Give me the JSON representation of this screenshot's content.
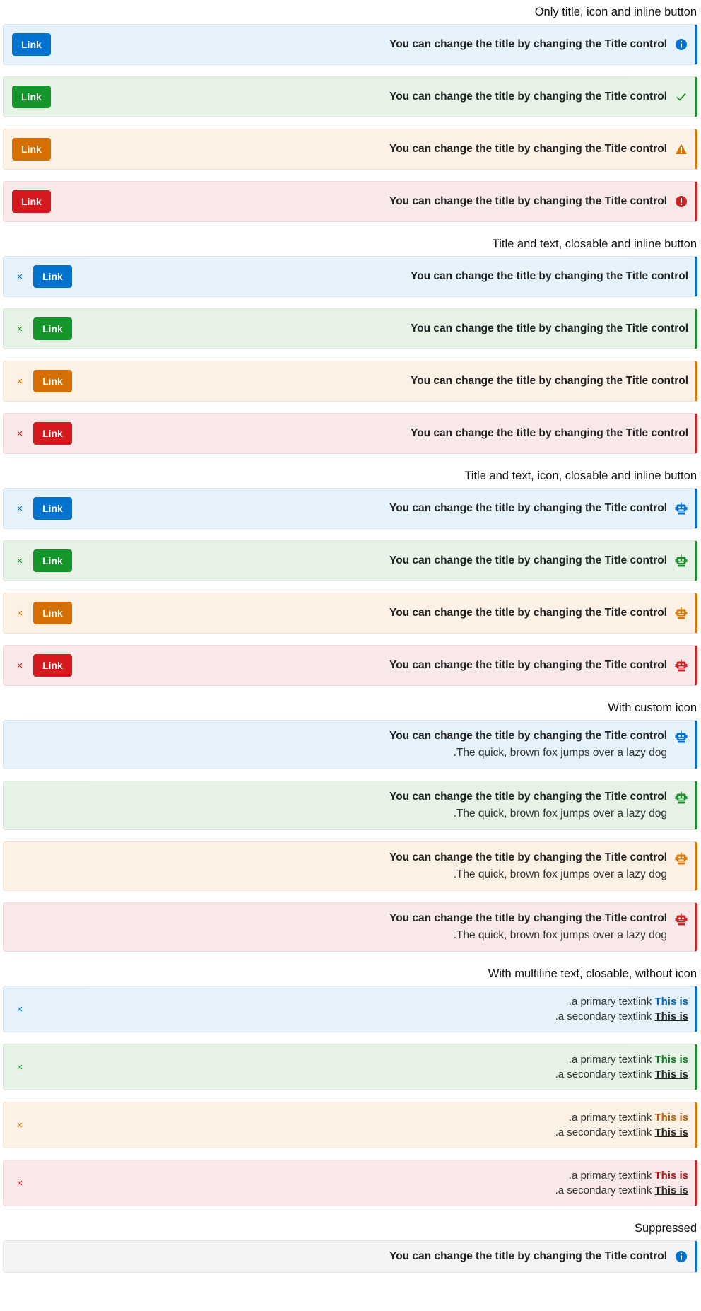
{
  "sections": {
    "s1": "Only title, icon and inline button",
    "s2": "Title and text, closable and inline button",
    "s3": "Title and text, icon, closable and inline button",
    "s4": "With custom icon",
    "s5": "With multiline text, closable, without icon",
    "s6": "Suppressed"
  },
  "common": {
    "title": "You can change the title by changing the Title control",
    "button": "Link",
    "close": "×",
    "body_text": ".The quick, brown fox jumps over a lazy dog",
    "primary_link": "This is",
    "primary_rest": ".a primary textlink ",
    "secondary_link": "This is",
    "secondary_rest": ".a secondary textlink "
  },
  "colors": {
    "info": "#0070d1",
    "success": "#1f8c2e",
    "warning": "#d97706",
    "error": "#cc2326"
  },
  "icons": {
    "info": "info-icon",
    "success": "checkmark-icon",
    "warning": "warning-icon",
    "error": "error-icon",
    "custom": "robot-icon"
  }
}
